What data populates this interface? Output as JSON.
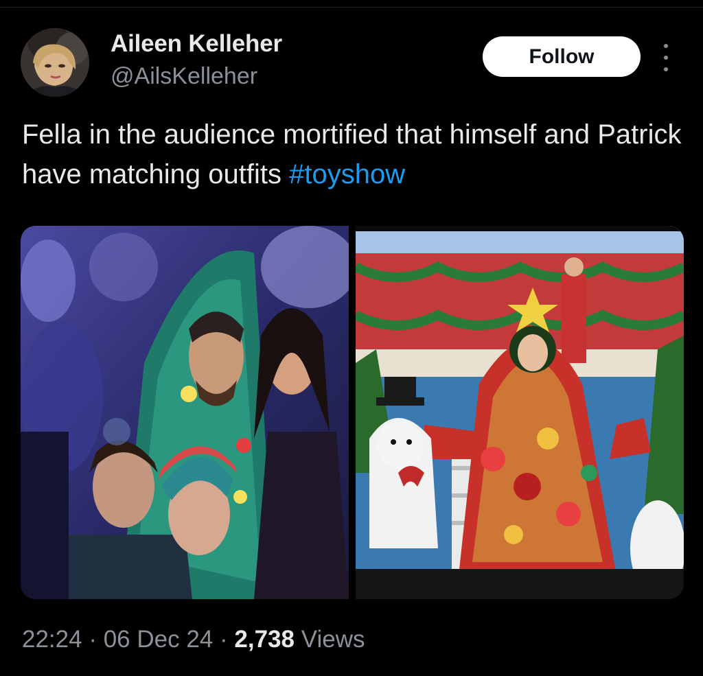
{
  "author": {
    "name": "Aileen Kelleher",
    "handle": "@AilsKelleher"
  },
  "actions": {
    "follow_label": "Follow",
    "more_icon": "more-vertical-icon"
  },
  "tweet": {
    "text": "Fella in the audience mortified that himself and Patrick have matching outfits ",
    "hashtag": "#toyshow"
  },
  "meta": {
    "time": "22:24",
    "separator": "·",
    "date": "06 Dec 24",
    "views_count": "2,738",
    "views_label": "Views"
  },
  "colors": {
    "background": "#000000",
    "text": "#e7e9ea",
    "muted": "#8b9198",
    "link": "#1d9bf0",
    "follow_bg": "#ffffff"
  }
}
